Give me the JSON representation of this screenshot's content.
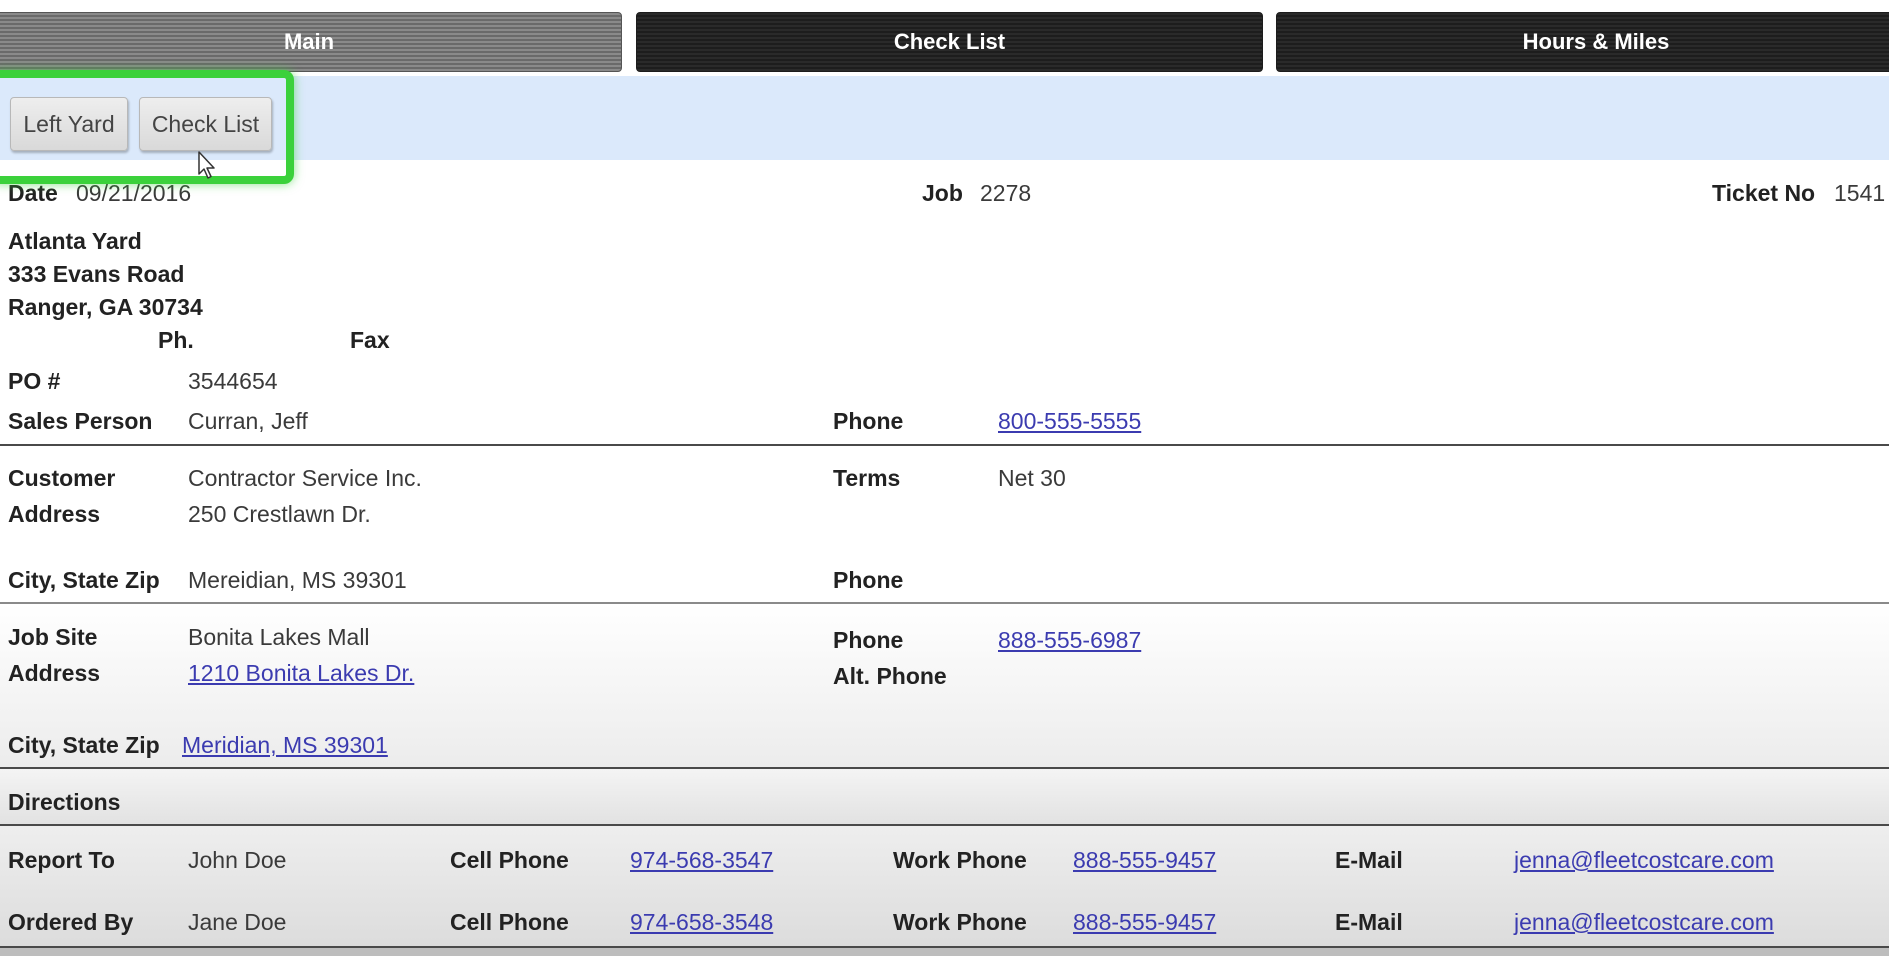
{
  "tabs": [
    {
      "label": "Main",
      "active": true
    },
    {
      "label": "Check List",
      "active": false
    },
    {
      "label": "Hours & Miles",
      "active": false
    }
  ],
  "toolbar": {
    "left_yard_label": "Left Yard",
    "check_list_label": "Check List"
  },
  "header": {
    "date_label": "Date",
    "date_value": "09/21/2016",
    "job_label": "Job",
    "job_value": "2278",
    "ticket_label": "Ticket No",
    "ticket_value": "1541"
  },
  "yard": {
    "name": "Atlanta Yard",
    "street": "333 Evans Road",
    "city_state_zip": "Ranger, GA 30734",
    "phone_label": "Ph.",
    "fax_label": "Fax"
  },
  "order": {
    "po_label": "PO #",
    "po_value": "3544654",
    "sales_person_label": "Sales Person",
    "sales_person_value": "Curran,  Jeff",
    "phone_label": "Phone",
    "phone_value": "800-555-5555"
  },
  "customer": {
    "customer_label": "Customer",
    "customer_value": "Contractor Service Inc.",
    "address_label": "Address",
    "address_value": "250 Crestlawn Dr.",
    "terms_label": "Terms",
    "terms_value": "Net 30",
    "city_label": "City, State Zip",
    "city_value": "Mereidian, MS 39301",
    "phone_label": "Phone"
  },
  "job_site": {
    "job_site_label": "Job Site",
    "job_site_value": "Bonita Lakes Mall",
    "address_label": "Address",
    "address_value": "1210 Bonita Lakes Dr.",
    "phone_label": "Phone",
    "phone_value": "888-555-6987",
    "alt_phone_label": "Alt. Phone",
    "city_label": "City, State Zip",
    "city_value": "Meridian, MS 39301"
  },
  "directions": {
    "label": "Directions"
  },
  "contacts": [
    {
      "role_label": "Report To",
      "name": "John Doe",
      "cell_label": "Cell Phone",
      "cell_value": "974-568-3547",
      "work_label": "Work Phone",
      "work_value": "888-555-9457",
      "email_label": "E-Mail",
      "email_value": "jenna@fleetcostcare.com"
    },
    {
      "role_label": "Ordered By",
      "name": "Jane Doe",
      "cell_label": "Cell Phone",
      "cell_value": "974-658-3548",
      "work_label": "Work Phone",
      "work_value": "888-555-9457",
      "email_label": "E-Mail",
      "email_value": "jenna@fleetcostcare.com"
    }
  ],
  "colors": {
    "toolbar_bg": "#dbe9fb",
    "highlight": "#3bd13b",
    "link": "#3b3bb0"
  }
}
